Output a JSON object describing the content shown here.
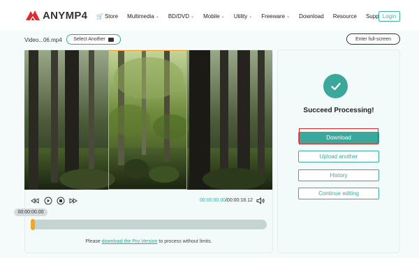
{
  "brand": {
    "name": "ANYMP4"
  },
  "nav": {
    "items": [
      {
        "label": "Store",
        "has_dropdown": false,
        "icon": "cart-icon"
      },
      {
        "label": "Multimedia",
        "has_dropdown": true
      },
      {
        "label": "BD/DVD",
        "has_dropdown": true
      },
      {
        "label": "Mobile",
        "has_dropdown": true
      },
      {
        "label": "Utility",
        "has_dropdown": true
      },
      {
        "label": "Freeware",
        "has_dropdown": true
      },
      {
        "label": "Download",
        "has_dropdown": false
      },
      {
        "label": "Resource",
        "has_dropdown": false
      },
      {
        "label": "Support",
        "has_dropdown": false
      }
    ],
    "login_label": "Login"
  },
  "editor": {
    "filename": "Video...06.mp4",
    "select_another_label": "Select Another",
    "fullscreen_label": "Enter full-screen",
    "current_time": "00:00:00.00",
    "total_time": "/00:00:18.12",
    "playhead_time": "00:00:00.00",
    "progress": 0.0,
    "notice_prefix": "Please ",
    "notice_link": "download the Pro Version",
    "notice_suffix": " to process without limits."
  },
  "result": {
    "title": "Succeed Processing!",
    "download_label": "Download",
    "upload_another_label": "Upload another",
    "history_label": "History",
    "continue_label": "Continue editing"
  },
  "colors": {
    "accent": "#3aa89a",
    "handle": "#f3a62a",
    "highlight": "#e52626",
    "cart": "#e12a2a"
  }
}
